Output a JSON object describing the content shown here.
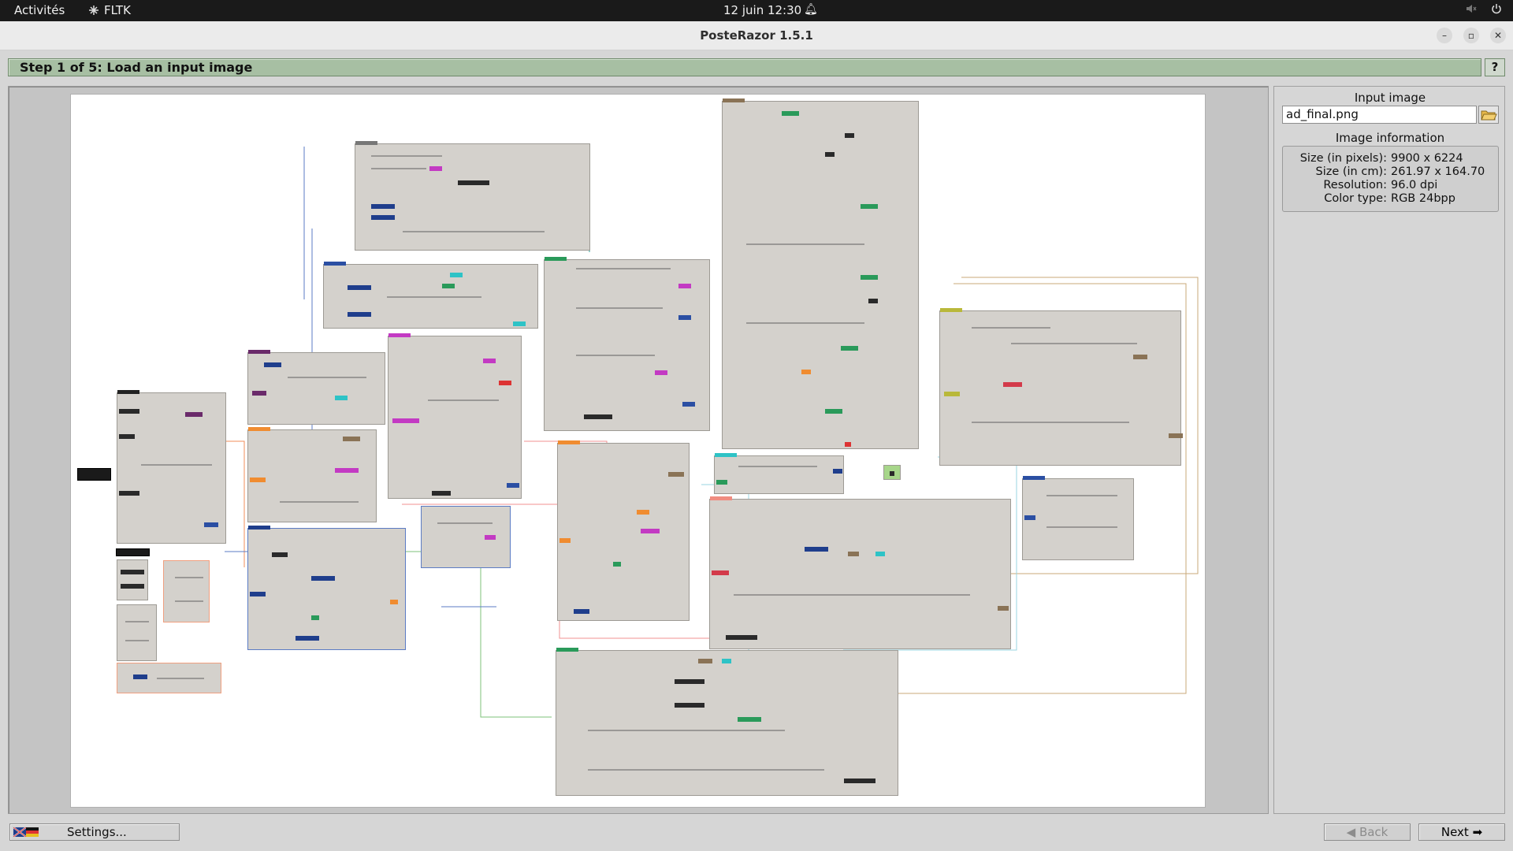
{
  "topbar": {
    "activities": "Activités",
    "app_name": "FLTK",
    "clock": "12 juin  12:30"
  },
  "window": {
    "title": "PosteRazor 1.5.1"
  },
  "step": {
    "text": "Step 1 of 5: Load an input image",
    "help_label": "?"
  },
  "input_image": {
    "heading": "Input image",
    "filename": "ad_final.png"
  },
  "image_information": {
    "heading": "Image information",
    "rows": [
      {
        "label": "Size (in pixels):",
        "value": "9900 x 6224"
      },
      {
        "label": "Size (in cm):",
        "value": "261.97 x 164.70"
      },
      {
        "label": "Resolution:",
        "value": "96.0 dpi"
      },
      {
        "label": "Color type:",
        "value": "RGB 24bpp"
      }
    ]
  },
  "bottom": {
    "settings_label": "Settings...",
    "back_label": "Back",
    "next_label": "Next"
  },
  "icons": {
    "app": "fltk-icon",
    "bell": "bell-icon",
    "speaker": "speaker-muted-icon",
    "power": "power-icon",
    "folder": "folder-open-icon",
    "back": "arrow-left-icon",
    "next": "arrow-right-icon",
    "flags": "language-flags-icon"
  },
  "colors": {
    "step_header": "#a7bfa3",
    "canvas": "#ffffff",
    "card": "#d4d1cc"
  }
}
